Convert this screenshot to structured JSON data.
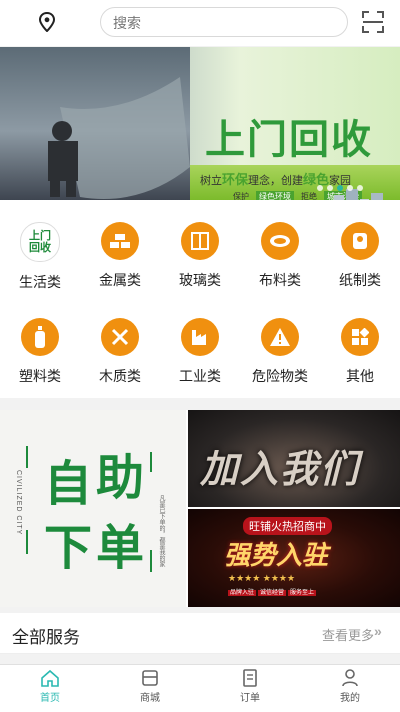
{
  "search": {
    "placeholder": "搜索"
  },
  "banner": {
    "title": "上门回收",
    "subtitle_prefix": "树立",
    "subtitle_hl1": "环保",
    "subtitle_mid": "理念，创建",
    "subtitle_hl2": "绿色",
    "subtitle_suffix": "家园",
    "tags": [
      "保护",
      "绿色环境",
      "拒绝",
      "城市污染"
    ],
    "colors": {
      "accent": "#2f9a3b"
    }
  },
  "categories": [
    {
      "label": "生活类",
      "icon": "recycle-badge-icon",
      "badge": "上门回收"
    },
    {
      "label": "金属类",
      "icon": "gold-bars-icon"
    },
    {
      "label": "玻璃类",
      "icon": "window-icon"
    },
    {
      "label": "布料类",
      "icon": "fabric-roll-icon"
    },
    {
      "label": "纸制类",
      "icon": "paper-roll-icon"
    },
    {
      "label": "塑料类",
      "icon": "bottle-icon"
    },
    {
      "label": "木质类",
      "icon": "tools-icon"
    },
    {
      "label": "工业类",
      "icon": "factory-icon"
    },
    {
      "label": "危险物类",
      "icon": "warning-icon"
    },
    {
      "label": "其他",
      "icon": "grid-icon"
    }
  ],
  "promo": {
    "self_order": {
      "line1a": "自",
      "line1b": "助",
      "line2a": "下",
      "line2b": "单",
      "side": "CIVILIZED CITY",
      "side2": "凡是已下单的，都是我的家"
    },
    "join": {
      "text": "加入我们"
    },
    "recruit": {
      "top": "旺铺火热招商中",
      "title": "强势入驻",
      "stars": "★★★★  ★★★★",
      "pills": [
        "品牌入驻",
        "诚信经营",
        "服务至上"
      ]
    }
  },
  "services": {
    "title": "全部服务",
    "more": "查看更多"
  },
  "tabbar": [
    {
      "label": "首页",
      "icon": "home-icon",
      "active": true
    },
    {
      "label": "商城",
      "icon": "shop-icon",
      "active": false
    },
    {
      "label": "订单",
      "icon": "order-icon",
      "active": false
    },
    {
      "label": "我的",
      "icon": "user-icon",
      "active": false
    }
  ],
  "colors": {
    "brand": "#2bb9b2",
    "category": "#f0900f"
  }
}
